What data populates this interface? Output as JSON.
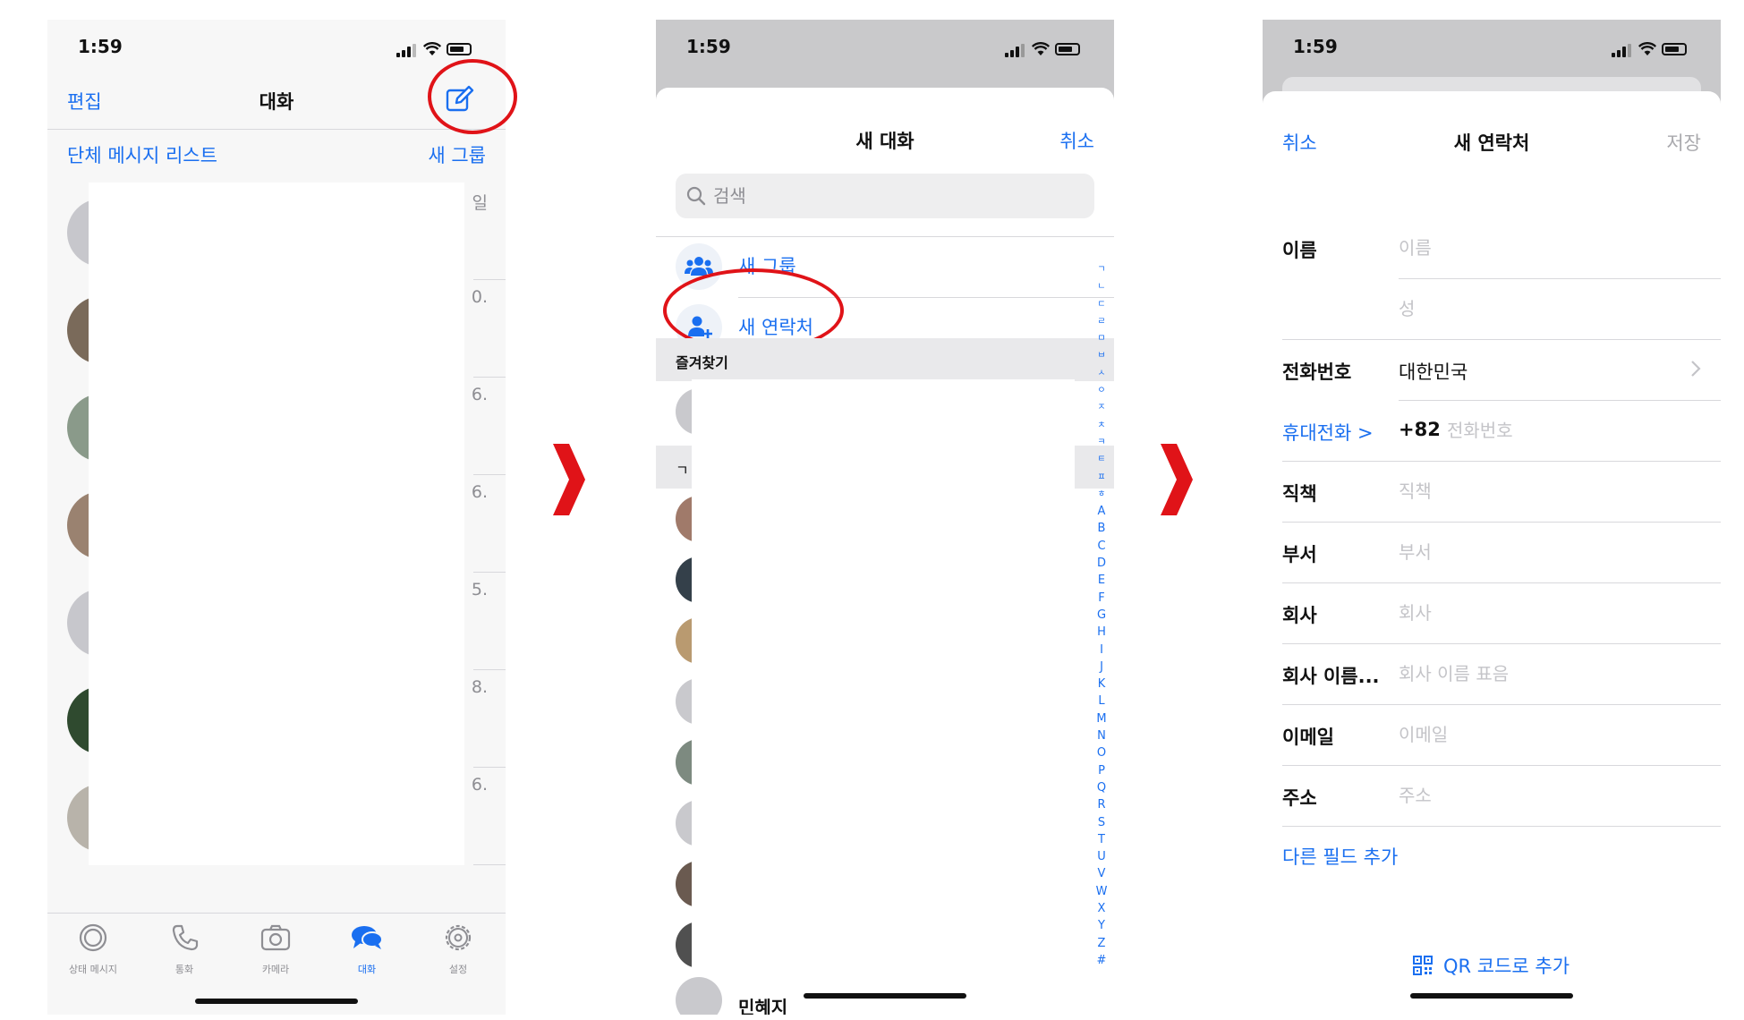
{
  "status": {
    "time": "1:59"
  },
  "chats_screen": {
    "edit_label": "편집",
    "title": "대화",
    "broadcast_label": "단체 메시지 리스트",
    "new_group_label": "새 그룹",
    "rows": [
      {
        "timestamp": "일"
      },
      {
        "timestamp": "0."
      },
      {
        "timestamp": "6."
      },
      {
        "timestamp": "6."
      },
      {
        "timestamp": "5."
      },
      {
        "timestamp": "8."
      },
      {
        "timestamp": "6."
      }
    ],
    "tabs": [
      {
        "label": "상태 메시지",
        "icon": "status-icon"
      },
      {
        "label": "통화",
        "icon": "phone-icon"
      },
      {
        "label": "카메라",
        "icon": "camera-icon"
      },
      {
        "label": "대화",
        "icon": "chats-icon",
        "active": true
      },
      {
        "label": "설정",
        "icon": "settings-icon"
      }
    ]
  },
  "new_chat_screen": {
    "title": "새 대화",
    "cancel_label": "취소",
    "search_placeholder": "검색",
    "new_group_label": "새 그룹",
    "new_contact_label": "새 연락처",
    "favorites_header": "즐겨찾기",
    "section_letter": "ㄱ",
    "peek_name": "민혜지",
    "index_letters": [
      "ㄱ",
      "ㄴ",
      "ㄷ",
      "ㄹ",
      "ㅁ",
      "ㅂ",
      "ㅅ",
      "ㅇ",
      "ㅈ",
      "ㅊ",
      "ㅋ",
      "ㅌ",
      "ㅍ",
      "ㅎ",
      "A",
      "B",
      "C",
      "D",
      "E",
      "F",
      "G",
      "H",
      "I",
      "J",
      "K",
      "L",
      "M",
      "N",
      "O",
      "P",
      "Q",
      "R",
      "S",
      "T",
      "U",
      "V",
      "W",
      "X",
      "Y",
      "Z",
      "#"
    ]
  },
  "new_contact_screen": {
    "cancel_label": "취소",
    "title": "새 연락처",
    "save_label": "저장",
    "name_label": "이름",
    "first_name_placeholder": "이름",
    "last_name_placeholder": "성",
    "phone_label": "전화번호",
    "country": "대한민국",
    "mobile_label": "휴대전화 >",
    "country_code": "+82",
    "phone_placeholder": "전화번호",
    "fields": [
      {
        "label": "직책",
        "placeholder": "직책"
      },
      {
        "label": "부서",
        "placeholder": "부서"
      },
      {
        "label": "회사",
        "placeholder": "회사"
      },
      {
        "label": "회사 이름...",
        "placeholder": "회사 이름 표음"
      },
      {
        "label": "이메일",
        "placeholder": "이메일"
      },
      {
        "label": "주소",
        "placeholder": "주소"
      }
    ],
    "add_field_label": "다른 필드 추가",
    "qr_label": "QR 코드로 추가"
  },
  "colors": {
    "accent": "#1a6ff0",
    "highlight_ring": "#e01318",
    "arrow": "#e01318"
  }
}
